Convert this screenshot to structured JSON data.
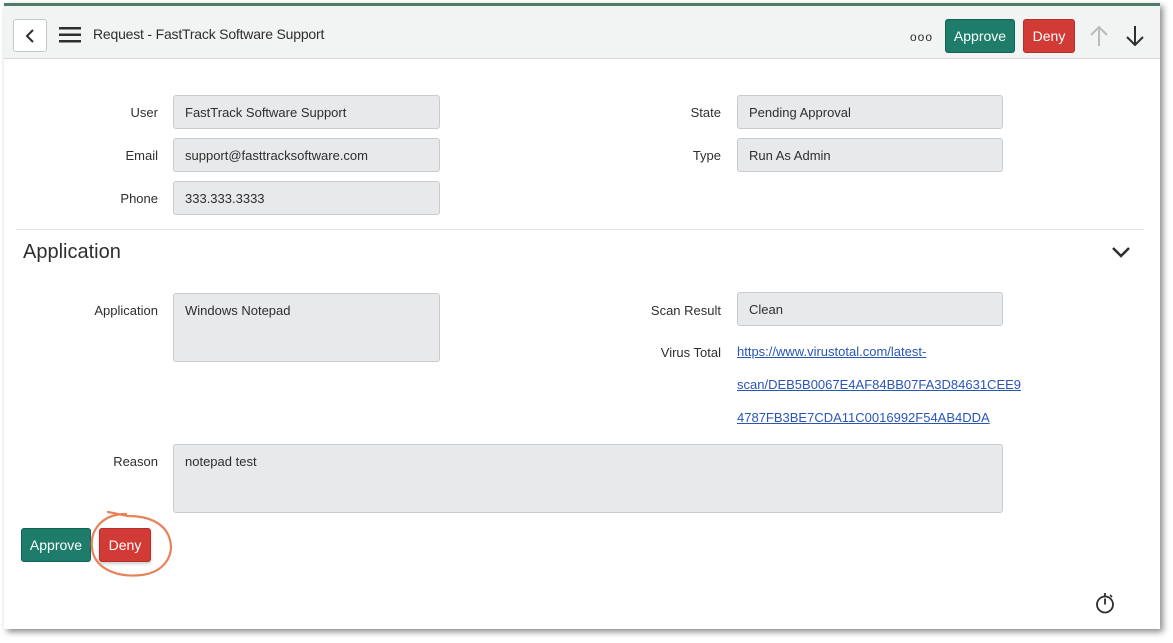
{
  "header": {
    "title": "Request - FastTrack Software Support",
    "more_label": "ooo",
    "approve_label": "Approve",
    "deny_label": "Deny"
  },
  "form": {
    "user_label": "User",
    "user_value": "FastTrack Software Support",
    "email_label": "Email",
    "email_value": "support@fasttracksoftware.com",
    "phone_label": "Phone",
    "phone_value": "333.333.3333",
    "state_label": "State",
    "state_value": "Pending Approval",
    "type_label": "Type",
    "type_value": "Run As Admin"
  },
  "application_section": {
    "title": "Application",
    "application_label": "Application",
    "application_value": "Windows Notepad",
    "scan_result_label": "Scan Result",
    "scan_result_value": "Clean",
    "virus_total_label": "Virus Total",
    "virus_total_link_lines": [
      "https://www.virustotal.com/latest-",
      "scan/DEB5B0067E4AF84BB07FA3D84631CEE9",
      "4787FB3BE7CDA11C0016992F54AB4DDA"
    ],
    "reason_label": "Reason",
    "reason_value": "notepad test"
  },
  "footer": {
    "approve_label": "Approve",
    "deny_label": "Deny"
  },
  "colors": {
    "approve": "#1d7d6a",
    "deny": "#d13a35",
    "annotation": "#e8825a",
    "link": "#2a55b5"
  },
  "icons": [
    "back-arrow-icon",
    "hamburger-menu-icon",
    "more-options-icon",
    "arrow-up-icon",
    "arrow-down-icon",
    "chevron-down-icon",
    "timer-icon"
  ]
}
